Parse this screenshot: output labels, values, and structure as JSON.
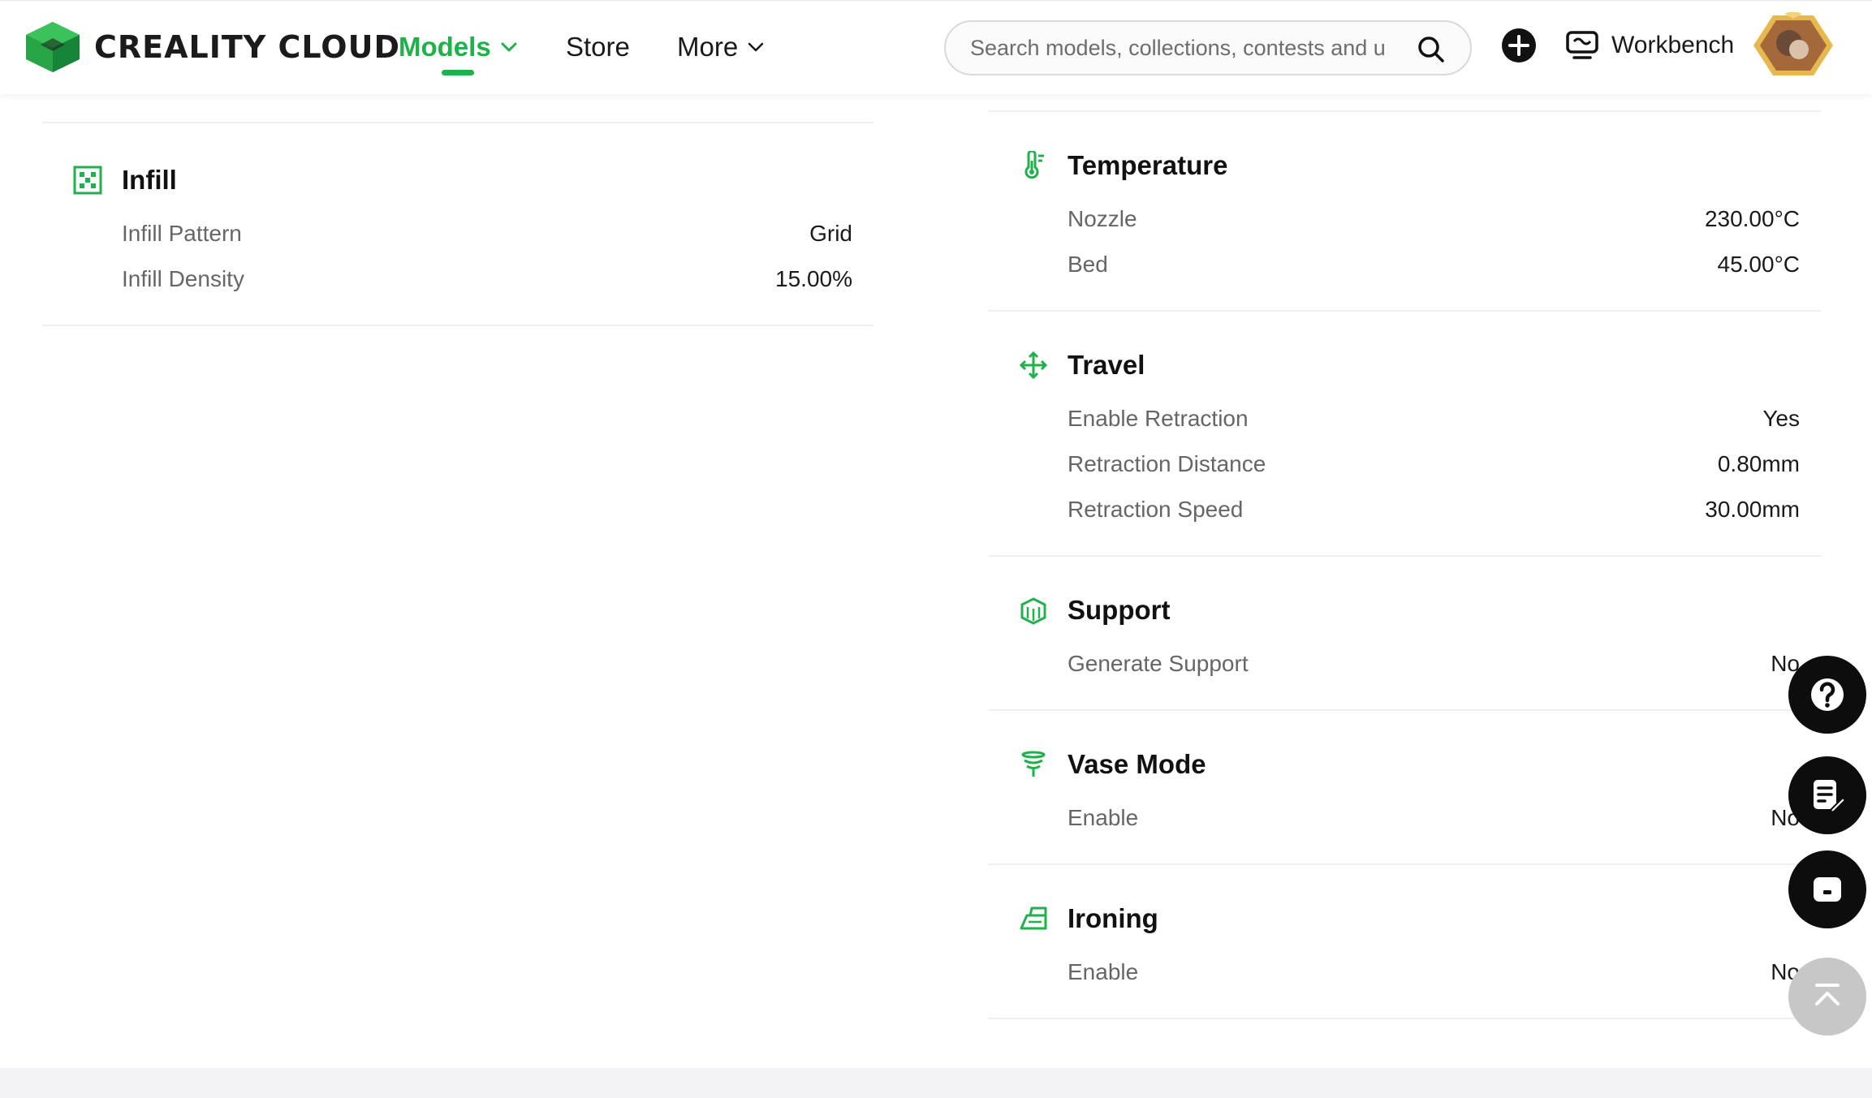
{
  "header": {
    "logo_text": "CREALITY CLOUD",
    "nav": {
      "models": "Models",
      "store": "Store",
      "more": "More"
    },
    "search_placeholder": "Search models, collections, contests and u",
    "workbench": "Workbench"
  },
  "left_panel": {
    "sections": [
      {
        "title": "Infill",
        "icon": "grid-icon",
        "rows": [
          {
            "key": "Infill Pattern",
            "value": "Grid"
          },
          {
            "key": "Infill Density",
            "value": "15.00%"
          }
        ]
      }
    ]
  },
  "right_panel": {
    "sections": [
      {
        "title": "Temperature",
        "icon": "thermometer-icon",
        "rows": [
          {
            "key": "Nozzle",
            "value": "230.00°C"
          },
          {
            "key": "Bed",
            "value": "45.00°C"
          }
        ]
      },
      {
        "title": "Travel",
        "icon": "move-arrows-icon",
        "rows": [
          {
            "key": "Enable Retraction",
            "value": "Yes"
          },
          {
            "key": "Retraction Distance",
            "value": "0.80mm"
          },
          {
            "key": "Retraction Speed",
            "value": "30.00mm"
          }
        ]
      },
      {
        "title": "Support",
        "icon": "support-cube-icon",
        "rows": [
          {
            "key": "Generate Support",
            "value": "No"
          }
        ]
      },
      {
        "title": "Vase Mode",
        "icon": "vase-spiral-icon",
        "rows": [
          {
            "key": "Enable",
            "value": "No"
          }
        ]
      },
      {
        "title": "Ironing",
        "icon": "iron-icon",
        "rows": [
          {
            "key": "Enable",
            "value": "No"
          }
        ]
      }
    ]
  },
  "colors": {
    "brand_green": "#1fb14a",
    "fab_dark": "#0d0d0d",
    "fab_light": "#c7c7c7"
  }
}
